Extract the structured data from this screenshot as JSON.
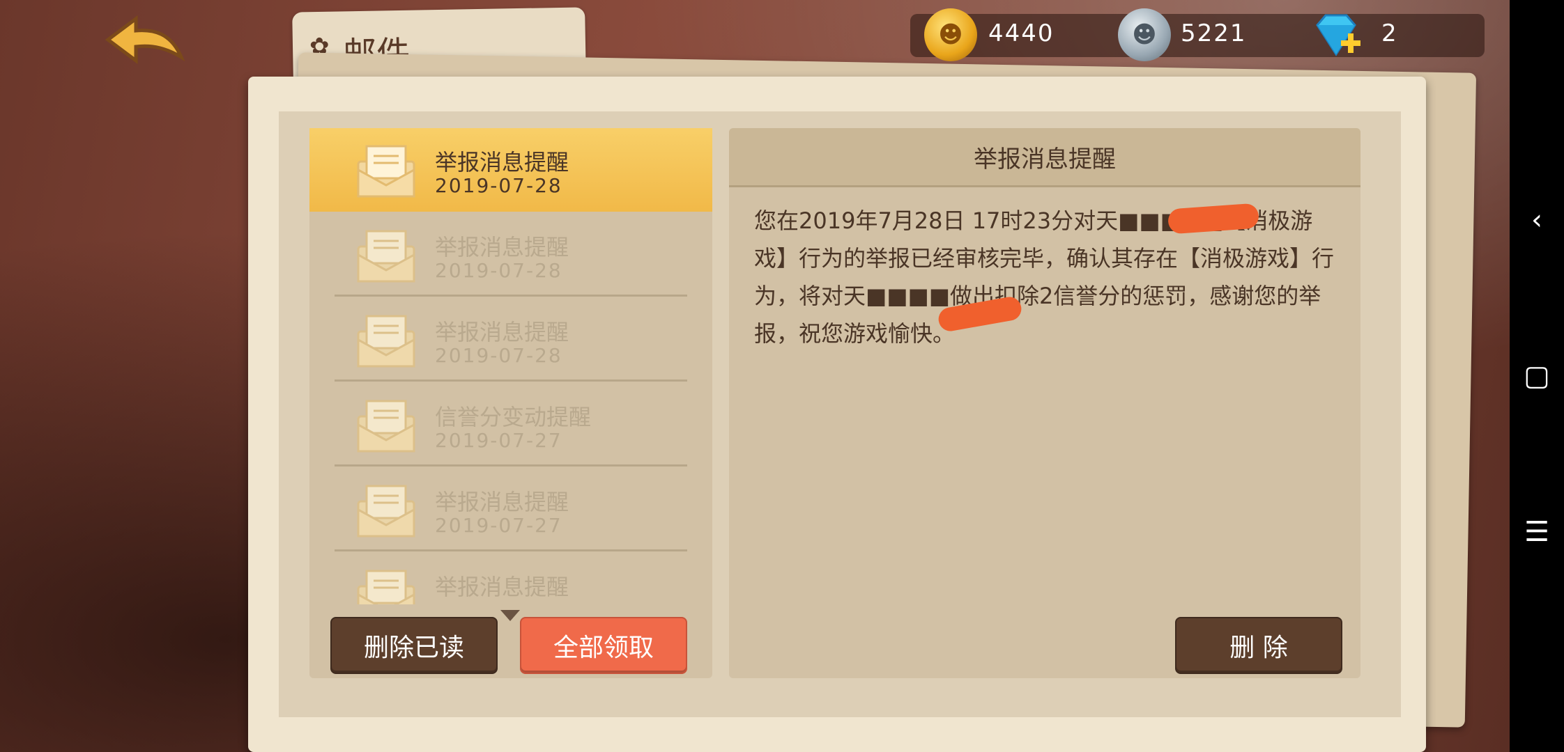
{
  "header": {
    "back_icon": "back-arrow-icon",
    "title": "邮件",
    "title_icon": "mail-badge-icon"
  },
  "currency": {
    "gold": "4440",
    "silver": "5221",
    "gems": "2"
  },
  "mail_list": [
    {
      "title": "举报消息提醒",
      "date": "2019-07-28",
      "active": true
    },
    {
      "title": "举报消息提醒",
      "date": "2019-07-28",
      "active": false
    },
    {
      "title": "举报消息提醒",
      "date": "2019-07-28",
      "active": false
    },
    {
      "title": "信誉分变动提醒",
      "date": "2019-07-27",
      "active": false
    },
    {
      "title": "举报消息提醒",
      "date": "2019-07-27",
      "active": false
    },
    {
      "title": "举报消息提醒",
      "date": "",
      "active": false
    }
  ],
  "buttons": {
    "delete_read": "删除已读",
    "claim_all": "全部领取",
    "delete": "删 除"
  },
  "detail": {
    "title": "举报消息提醒",
    "body": "您在2019年7月28日 17时23分对天■■■■■【消极游戏】行为的举报已经审核完毕，确认其存在【消极游戏】行为，将对天■■■■做出扣除2信誉分的惩罚，感谢您的举报，祝您游戏愉快。"
  },
  "colors": {
    "accent_orange": "#f06a4a",
    "active_row": "#f1b948",
    "dark_button": "#5d3f2c"
  }
}
